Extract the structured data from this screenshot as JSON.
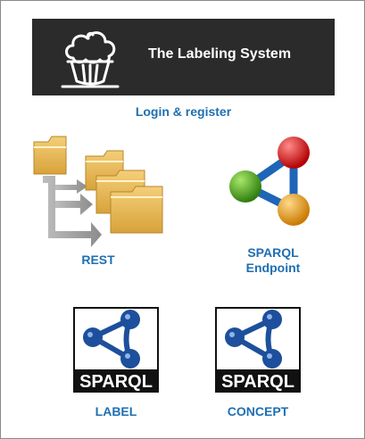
{
  "banner": {
    "title": "The Labeling System",
    "logo_icon": "cupcake-logo-icon"
  },
  "links": {
    "login_register": "Login & register"
  },
  "services": [
    {
      "label": "REST",
      "icon": "folder-tree-icon"
    },
    {
      "label_line1": "SPARQL",
      "label_line2": "Endpoint",
      "icon": "rdf-graph-icon"
    },
    {
      "label": "LABEL",
      "icon": "sparql-logo-icon",
      "logo_text": "SPARQL"
    },
    {
      "label": "CONCEPT",
      "icon": "sparql-logo-icon",
      "logo_text": "SPARQL"
    }
  ],
  "colors": {
    "banner_bg": "#2b2b2b",
    "link": "#1f6fb2",
    "sparql_blue": "#1d4f9c",
    "node_red": "#cc1a1a",
    "node_green": "#4aa31e",
    "node_orange": "#e99a12"
  }
}
